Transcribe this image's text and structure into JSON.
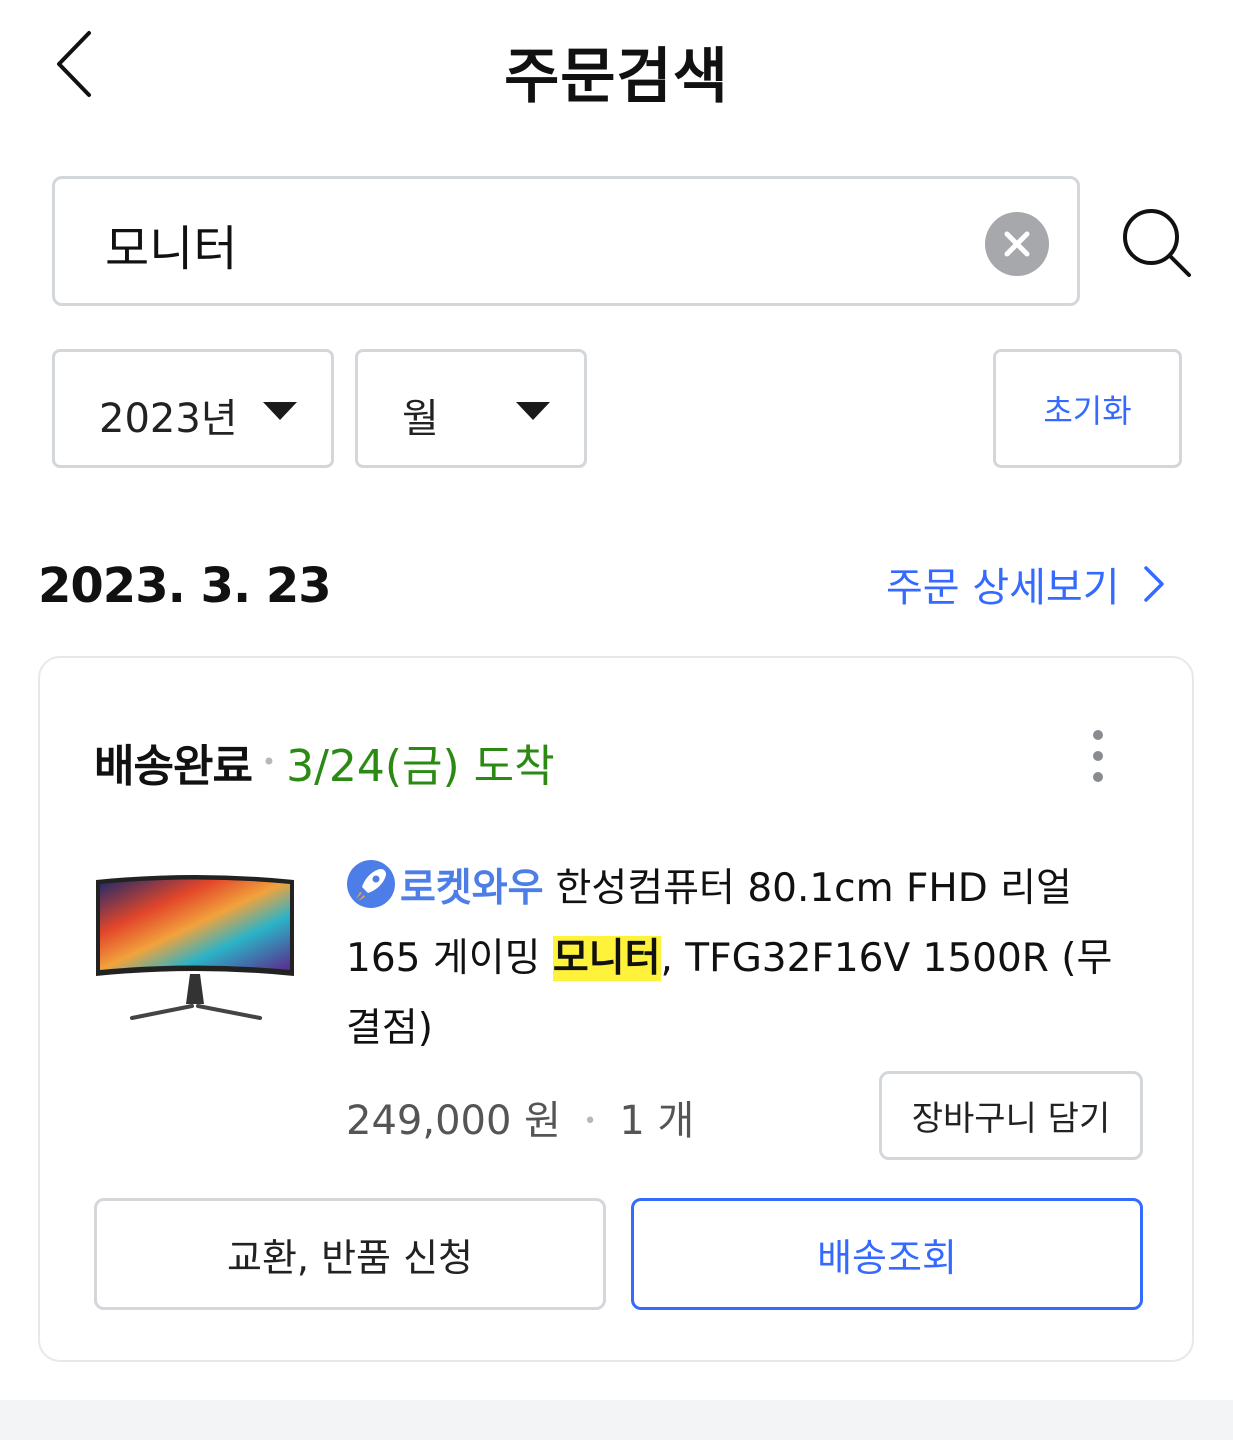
{
  "header": {
    "title": "주문검색"
  },
  "search": {
    "value": "모니터"
  },
  "filters": {
    "year": "2023년",
    "month": "월",
    "reset_label": "초기화"
  },
  "order": {
    "date": "2023. 3. 23",
    "detail_link": "주문 상세보기",
    "status": "배송완료",
    "arrival": "3/24(금) 도착",
    "product": {
      "badge": "로켓와우",
      "title_before": "한성컴퓨터 80.1cm FHD 리얼 165 게이밍 ",
      "title_highlight": "모니터",
      "title_after": ", TFG32F16V 1500R (무결점)",
      "price": "249,000 원",
      "quantity": "1 개"
    },
    "cart_button": "장바구니 담기",
    "return_button": "교환, 반품 신청",
    "track_button": "배송조회"
  },
  "colors": {
    "accent": "#346aff",
    "arrival": "#2b8a14",
    "highlight": "#fff23a"
  },
  "icons": {
    "back": "chevron-left-icon",
    "clear": "clear-circle-icon",
    "search": "search-icon",
    "dropdown": "caret-down-icon",
    "more": "more-vertical-icon",
    "rocket": "rocket-icon"
  }
}
